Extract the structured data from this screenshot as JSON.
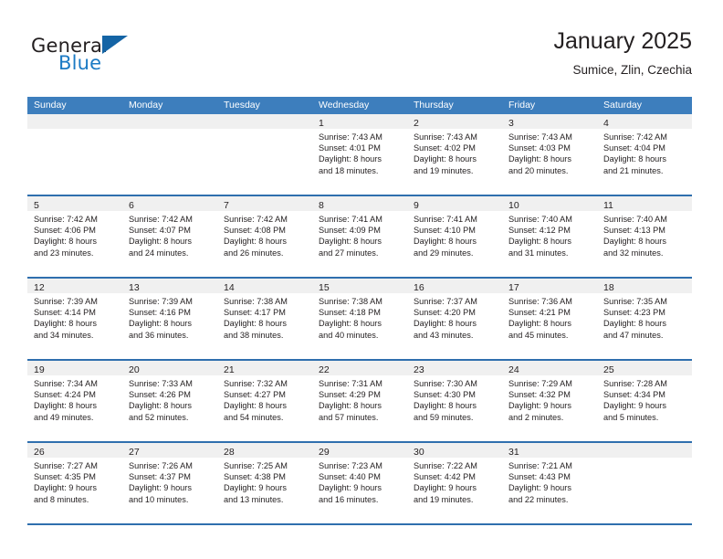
{
  "brand": {
    "line1": "General",
    "line2": "Blue",
    "icon": "triangle-logo"
  },
  "header": {
    "title": "January 2025",
    "subtitle": "Sumice, Zlin, Czechia"
  },
  "colors": {
    "header_bar": "#3d7ebd",
    "grid_line": "#2f6fae",
    "daynum_band": "#f0f0f0",
    "brand_blue": "#1b7ac4",
    "text": "#231f20"
  },
  "weekdays": [
    "Sunday",
    "Monday",
    "Tuesday",
    "Wednesday",
    "Thursday",
    "Friday",
    "Saturday"
  ],
  "weeks": [
    [
      {
        "day": "",
        "lines": []
      },
      {
        "day": "",
        "lines": []
      },
      {
        "day": "",
        "lines": []
      },
      {
        "day": "1",
        "lines": [
          "Sunrise: 7:43 AM",
          "Sunset: 4:01 PM",
          "Daylight: 8 hours",
          "and 18 minutes."
        ]
      },
      {
        "day": "2",
        "lines": [
          "Sunrise: 7:43 AM",
          "Sunset: 4:02 PM",
          "Daylight: 8 hours",
          "and 19 minutes."
        ]
      },
      {
        "day": "3",
        "lines": [
          "Sunrise: 7:43 AM",
          "Sunset: 4:03 PM",
          "Daylight: 8 hours",
          "and 20 minutes."
        ]
      },
      {
        "day": "4",
        "lines": [
          "Sunrise: 7:42 AM",
          "Sunset: 4:04 PM",
          "Daylight: 8 hours",
          "and 21 minutes."
        ]
      }
    ],
    [
      {
        "day": "5",
        "lines": [
          "Sunrise: 7:42 AM",
          "Sunset: 4:06 PM",
          "Daylight: 8 hours",
          "and 23 minutes."
        ]
      },
      {
        "day": "6",
        "lines": [
          "Sunrise: 7:42 AM",
          "Sunset: 4:07 PM",
          "Daylight: 8 hours",
          "and 24 minutes."
        ]
      },
      {
        "day": "7",
        "lines": [
          "Sunrise: 7:42 AM",
          "Sunset: 4:08 PM",
          "Daylight: 8 hours",
          "and 26 minutes."
        ]
      },
      {
        "day": "8",
        "lines": [
          "Sunrise: 7:41 AM",
          "Sunset: 4:09 PM",
          "Daylight: 8 hours",
          "and 27 minutes."
        ]
      },
      {
        "day": "9",
        "lines": [
          "Sunrise: 7:41 AM",
          "Sunset: 4:10 PM",
          "Daylight: 8 hours",
          "and 29 minutes."
        ]
      },
      {
        "day": "10",
        "lines": [
          "Sunrise: 7:40 AM",
          "Sunset: 4:12 PM",
          "Daylight: 8 hours",
          "and 31 minutes."
        ]
      },
      {
        "day": "11",
        "lines": [
          "Sunrise: 7:40 AM",
          "Sunset: 4:13 PM",
          "Daylight: 8 hours",
          "and 32 minutes."
        ]
      }
    ],
    [
      {
        "day": "12",
        "lines": [
          "Sunrise: 7:39 AM",
          "Sunset: 4:14 PM",
          "Daylight: 8 hours",
          "and 34 minutes."
        ]
      },
      {
        "day": "13",
        "lines": [
          "Sunrise: 7:39 AM",
          "Sunset: 4:16 PM",
          "Daylight: 8 hours",
          "and 36 minutes."
        ]
      },
      {
        "day": "14",
        "lines": [
          "Sunrise: 7:38 AM",
          "Sunset: 4:17 PM",
          "Daylight: 8 hours",
          "and 38 minutes."
        ]
      },
      {
        "day": "15",
        "lines": [
          "Sunrise: 7:38 AM",
          "Sunset: 4:18 PM",
          "Daylight: 8 hours",
          "and 40 minutes."
        ]
      },
      {
        "day": "16",
        "lines": [
          "Sunrise: 7:37 AM",
          "Sunset: 4:20 PM",
          "Daylight: 8 hours",
          "and 43 minutes."
        ]
      },
      {
        "day": "17",
        "lines": [
          "Sunrise: 7:36 AM",
          "Sunset: 4:21 PM",
          "Daylight: 8 hours",
          "and 45 minutes."
        ]
      },
      {
        "day": "18",
        "lines": [
          "Sunrise: 7:35 AM",
          "Sunset: 4:23 PM",
          "Daylight: 8 hours",
          "and 47 minutes."
        ]
      }
    ],
    [
      {
        "day": "19",
        "lines": [
          "Sunrise: 7:34 AM",
          "Sunset: 4:24 PM",
          "Daylight: 8 hours",
          "and 49 minutes."
        ]
      },
      {
        "day": "20",
        "lines": [
          "Sunrise: 7:33 AM",
          "Sunset: 4:26 PM",
          "Daylight: 8 hours",
          "and 52 minutes."
        ]
      },
      {
        "day": "21",
        "lines": [
          "Sunrise: 7:32 AM",
          "Sunset: 4:27 PM",
          "Daylight: 8 hours",
          "and 54 minutes."
        ]
      },
      {
        "day": "22",
        "lines": [
          "Sunrise: 7:31 AM",
          "Sunset: 4:29 PM",
          "Daylight: 8 hours",
          "and 57 minutes."
        ]
      },
      {
        "day": "23",
        "lines": [
          "Sunrise: 7:30 AM",
          "Sunset: 4:30 PM",
          "Daylight: 8 hours",
          "and 59 minutes."
        ]
      },
      {
        "day": "24",
        "lines": [
          "Sunrise: 7:29 AM",
          "Sunset: 4:32 PM",
          "Daylight: 9 hours",
          "and 2 minutes."
        ]
      },
      {
        "day": "25",
        "lines": [
          "Sunrise: 7:28 AM",
          "Sunset: 4:34 PM",
          "Daylight: 9 hours",
          "and 5 minutes."
        ]
      }
    ],
    [
      {
        "day": "26",
        "lines": [
          "Sunrise: 7:27 AM",
          "Sunset: 4:35 PM",
          "Daylight: 9 hours",
          "and 8 minutes."
        ]
      },
      {
        "day": "27",
        "lines": [
          "Sunrise: 7:26 AM",
          "Sunset: 4:37 PM",
          "Daylight: 9 hours",
          "and 10 minutes."
        ]
      },
      {
        "day": "28",
        "lines": [
          "Sunrise: 7:25 AM",
          "Sunset: 4:38 PM",
          "Daylight: 9 hours",
          "and 13 minutes."
        ]
      },
      {
        "day": "29",
        "lines": [
          "Sunrise: 7:23 AM",
          "Sunset: 4:40 PM",
          "Daylight: 9 hours",
          "and 16 minutes."
        ]
      },
      {
        "day": "30",
        "lines": [
          "Sunrise: 7:22 AM",
          "Sunset: 4:42 PM",
          "Daylight: 9 hours",
          "and 19 minutes."
        ]
      },
      {
        "day": "31",
        "lines": [
          "Sunrise: 7:21 AM",
          "Sunset: 4:43 PM",
          "Daylight: 9 hours",
          "and 22 minutes."
        ]
      },
      {
        "day": "",
        "lines": []
      }
    ]
  ]
}
